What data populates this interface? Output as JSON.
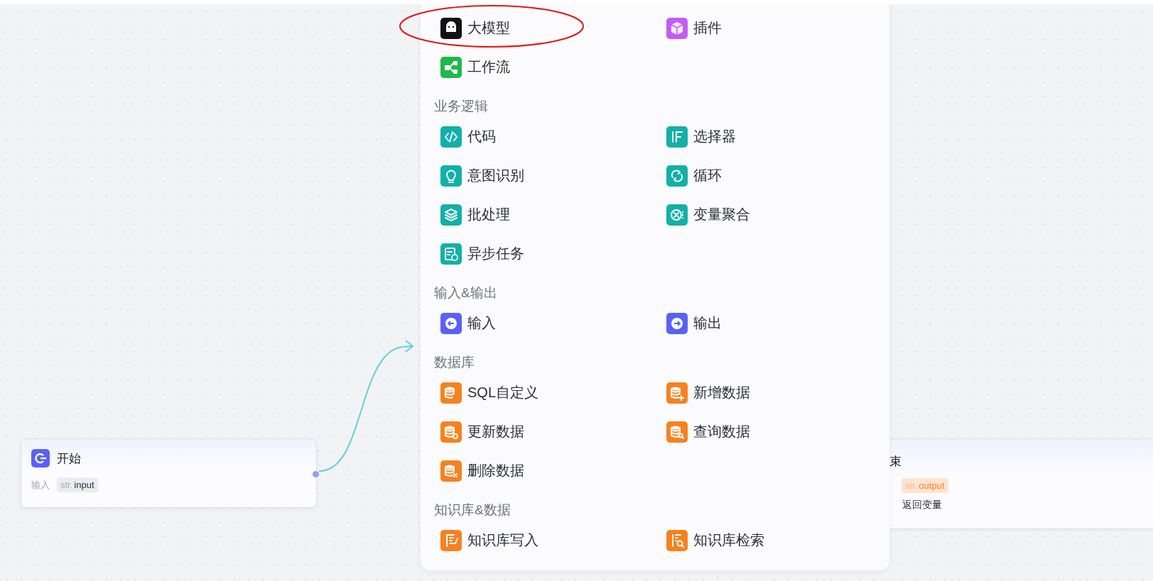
{
  "menu": {
    "sections": [
      {
        "items": [
          {
            "label": "大模型",
            "color": "#111111",
            "circled": true
          },
          {
            "label": "插件",
            "color": "#c35cf5",
            "circled": false
          },
          {
            "label": "工作流",
            "color": "#1fb84a",
            "circled": false
          }
        ]
      },
      {
        "heading": "业务逻辑",
        "items": [
          {
            "label": "代码",
            "color": "#12b0a9",
            "circled": false
          },
          {
            "label": "选择器",
            "color": "#12b0a9",
            "circled": false
          },
          {
            "label": "意图识别",
            "color": "#12b0a9",
            "circled": false
          },
          {
            "label": "循环",
            "color": "#12b0a9",
            "circled": false
          },
          {
            "label": "批处理",
            "color": "#12b0a9",
            "circled": false
          },
          {
            "label": "变量聚合",
            "color": "#12b0a9",
            "circled": false
          },
          {
            "label": "异步任务",
            "color": "#12b0a9",
            "circled": false
          }
        ]
      },
      {
        "heading": "输入&输出",
        "items": [
          {
            "label": "输入",
            "color": "#5a61f6",
            "circled": false
          },
          {
            "label": "输出",
            "color": "#5a61f6",
            "circled": false
          }
        ]
      },
      {
        "heading": "数据库",
        "items": [
          {
            "label": "SQL自定义",
            "color": "#f7811f",
            "circled": false
          },
          {
            "label": "新增数据",
            "color": "#f7811f",
            "circled": false
          },
          {
            "label": "更新数据",
            "color": "#f7811f",
            "circled": false
          },
          {
            "label": "查询数据",
            "color": "#f7811f",
            "circled": false
          },
          {
            "label": "删除数据",
            "color": "#f7811f",
            "circled": false
          }
        ]
      },
      {
        "heading": "知识库&数据",
        "items": [
          {
            "label": "知识库写入",
            "color": "#f7811f",
            "circled": false
          },
          {
            "label": "知识库检索",
            "color": "#f7811f",
            "circled": false
          }
        ]
      }
    ]
  },
  "start_node": {
    "title": "开始",
    "fields": [
      {
        "label": "输入",
        "type": "str.",
        "name": "input"
      }
    ]
  },
  "end_node": {
    "title": "束",
    "output_tag": {
      "type": "str.",
      "name": "output"
    },
    "return_text": "返回变量"
  }
}
